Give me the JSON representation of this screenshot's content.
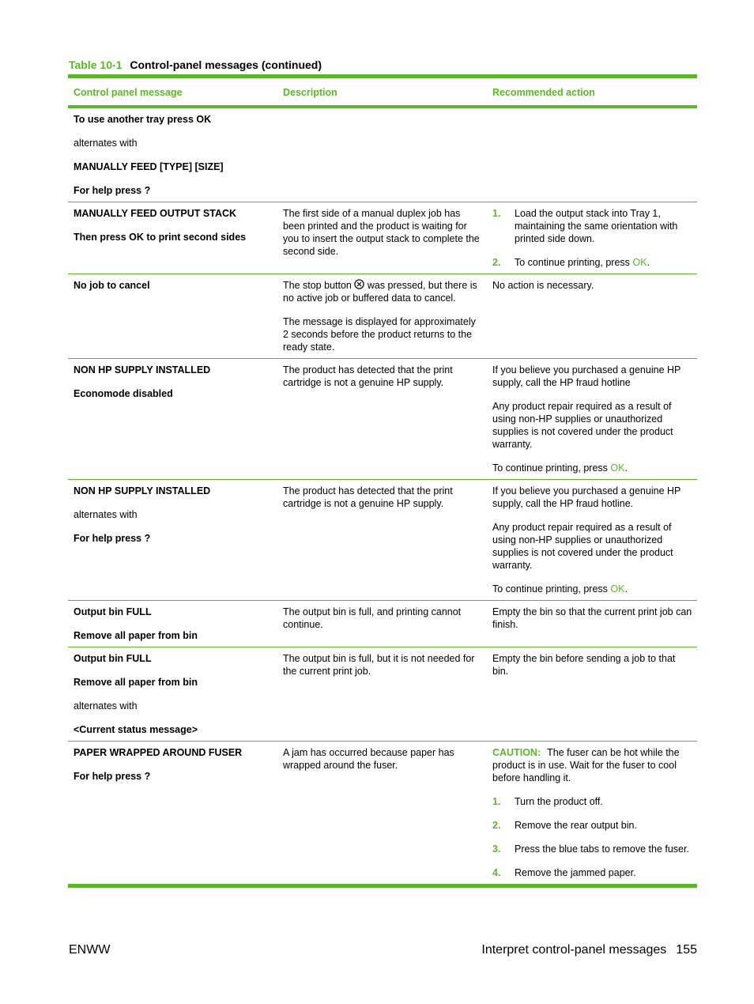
{
  "caption": {
    "number": "Table 10-1",
    "title": "Control-panel messages (continued)"
  },
  "columns": [
    "Control panel message",
    "Description",
    "Recommended action"
  ],
  "rows": [
    {
      "message": [
        {
          "text": "To use another tray press OK",
          "bold": true
        },
        {
          "text": "alternates with",
          "bold": false
        },
        {
          "text": "MANUALLY FEED [TYPE] [SIZE]",
          "bold": true
        },
        {
          "text": "For help press ?",
          "bold": true
        }
      ],
      "description": [],
      "action": []
    },
    {
      "message": [
        {
          "text": "MANUALLY FEED OUTPUT STACK",
          "bold": true
        },
        {
          "text": "Then press OK to print second sides",
          "bold": true
        }
      ],
      "description": [
        "The first side of a manual duplex job has been printed and the product is waiting for you to insert the output stack to complete the second side."
      ],
      "action_steps": [
        {
          "n": "1.",
          "text": "Load the output stack into Tray 1, maintaining the same orientation with printed side down."
        },
        {
          "n": "2.",
          "text": "To continue printing, press ",
          "link": "OK",
          "after": "."
        }
      ]
    },
    {
      "message": [
        {
          "text": "No job to cancel",
          "bold": true
        }
      ],
      "description_stop": {
        "before": "The stop button ",
        "icon": "stop-x-circle-icon",
        "after": " was pressed, but there is no active job or buffered data to cancel."
      },
      "description": [
        "The message is displayed for approximately 2 seconds before the product returns to the ready state."
      ],
      "action": [
        "No action is necessary."
      ]
    },
    {
      "message": [
        {
          "text": "NON HP SUPPLY INSTALLED",
          "bold": true
        },
        {
          "text": "Economode disabled",
          "bold": true
        }
      ],
      "description": [
        "The product has detected that the print cartridge is not a genuine HP supply."
      ],
      "action": [
        "If you believe you purchased a genuine HP supply, call the HP fraud hotline",
        "Any product repair required as a result of using non-HP supplies or unauthorized supplies is not covered under the product warranty."
      ],
      "action_continue": {
        "text": "To continue printing, press ",
        "link": "OK",
        "after": "."
      }
    },
    {
      "message": [
        {
          "text": "NON HP SUPPLY INSTALLED",
          "bold": true
        },
        {
          "text": "alternates with",
          "bold": false
        },
        {
          "text": "For help press ?",
          "bold": true
        }
      ],
      "description": [
        "The product has detected that the print cartridge is not a genuine HP supply."
      ],
      "action": [
        "If you believe you purchased a genuine HP supply, call the HP fraud hotline.",
        "Any product repair required as a result of using non-HP supplies or unauthorized supplies is not covered under the product warranty."
      ],
      "action_continue": {
        "text": "To continue printing, press ",
        "link": "OK",
        "after": "."
      }
    },
    {
      "message": [
        {
          "text": "Output bin FULL",
          "bold": true
        },
        {
          "text": "Remove all paper from bin",
          "bold": true
        }
      ],
      "description": [
        "The output bin is full, and printing cannot continue."
      ],
      "action": [
        "Empty the bin so that the current print job can finish."
      ]
    },
    {
      "message": [
        {
          "text": "Output bin FULL",
          "bold": true
        },
        {
          "text": "Remove all paper from bin",
          "bold": true
        },
        {
          "text": "alternates with",
          "bold": false
        },
        {
          "text": "<Current status message>",
          "bold": true
        }
      ],
      "description": [
        "The output bin is full, but it is not needed for the current print job."
      ],
      "action": [
        "Empty the bin before sending a job to that bin."
      ]
    },
    {
      "message": [
        {
          "text": "PAPER WRAPPED AROUND FUSER",
          "bold": true
        },
        {
          "text": "For help press ?",
          "bold": true
        }
      ],
      "description": [
        "A jam has occurred because paper has wrapped around the fuser."
      ],
      "caution": {
        "label": "CAUTION:",
        "text": "The fuser can be hot while the product is in use. Wait for the fuser to cool before handling it."
      },
      "action_steps": [
        {
          "n": "1.",
          "text": "Turn the product off."
        },
        {
          "n": "2.",
          "text": "Remove the rear output bin."
        },
        {
          "n": "3.",
          "text": "Press the blue tabs to remove the fuser."
        },
        {
          "n": "4.",
          "text": "Remove the jammed paper."
        }
      ]
    }
  ],
  "footer": {
    "left": "ENWW",
    "right": "Interpret control-panel messages",
    "page": "155"
  }
}
